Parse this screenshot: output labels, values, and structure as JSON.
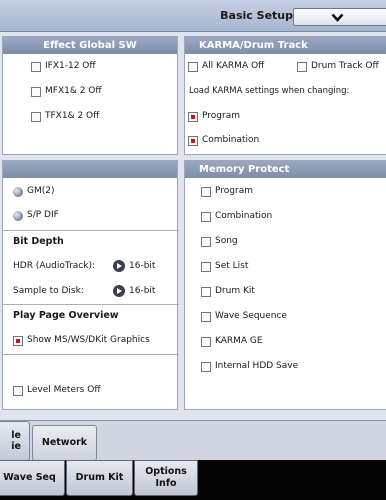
{
  "header": {
    "page_title": "Basic Setup",
    "dropdown_icon": "chevron-down-icon"
  },
  "effect_global_sw": {
    "title": "Effect Global SW",
    "items": [
      {
        "label": "IFX1-12 Off",
        "checked": false
      },
      {
        "label": "MFX1& 2 Off",
        "checked": false
      },
      {
        "label": "TFX1& 2 Off",
        "checked": false
      }
    ]
  },
  "karma_drum_track": {
    "title": "KARMA/Drum Track",
    "all_karma_off": "All KARMA Off",
    "drum_track_off": "Drum Track Off",
    "load_label": "Load KARMA settings when changing:",
    "program": "Program",
    "combination": "Combination"
  },
  "left_panel": {
    "gm2": "GM(2)",
    "spdif": "S/P DIF",
    "bit_depth_heading": "Bit Depth",
    "hdr_label": "HDR (AudioTrack):",
    "hdr_value": "16-bit",
    "sample_label": "Sample to Disk:",
    "sample_value": "16-bit",
    "play_page_heading": "Play Page Overview",
    "show_graphics": "Show MS/WS/DKit Graphics",
    "level_meters_off": "Level Meters Off"
  },
  "memory_protect": {
    "title": "Memory Protect",
    "items": [
      "Program",
      "Combination",
      "Song",
      "Set List",
      "Drum Kit",
      "Wave Sequence",
      "KARMA GE",
      "Internal HDD Save"
    ]
  },
  "tabs_row1": {
    "partial_line1": "le",
    "partial_line2": "ie",
    "network": "Network"
  },
  "tabs_row2": {
    "wave_seq": "Wave Seq",
    "drum_kit": "Drum Kit",
    "options_line1": "Options",
    "options_line2": "Info"
  }
}
